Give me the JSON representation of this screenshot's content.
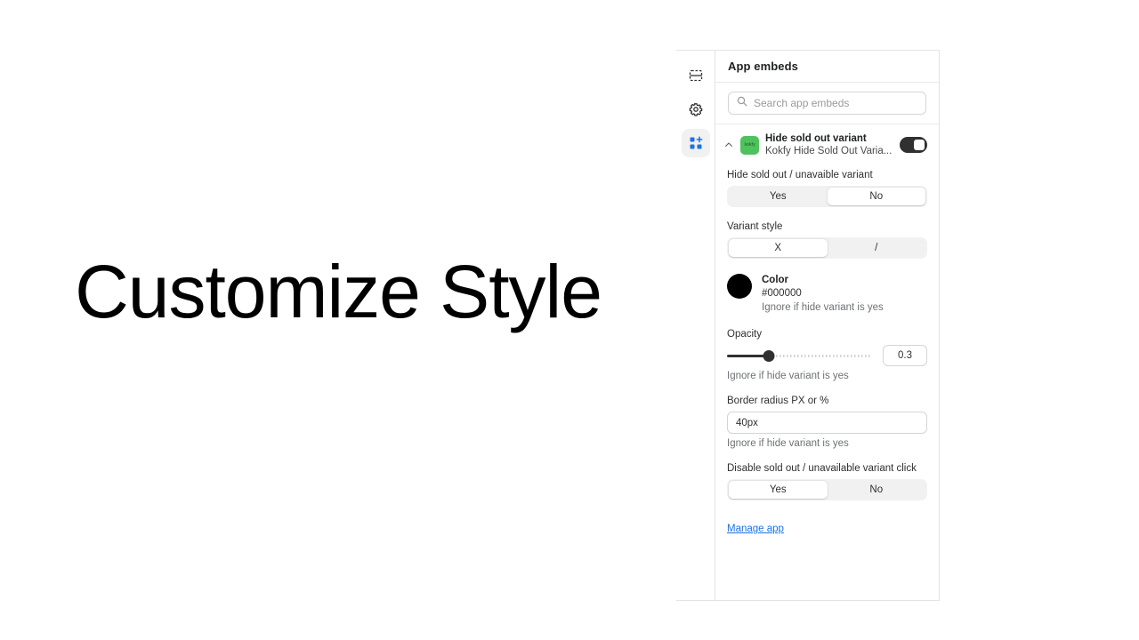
{
  "canvas": {
    "heading": "Customize Style"
  },
  "sidebar": {
    "items": [
      {
        "icon": "sections-icon",
        "name": "sections",
        "active": false
      },
      {
        "icon": "gear-icon",
        "name": "settings",
        "active": false
      },
      {
        "icon": "app-blocks-icon",
        "name": "app-embeds",
        "active": true
      }
    ]
  },
  "panel": {
    "title": "App embeds",
    "search": {
      "placeholder": "Search app embeds",
      "value": "",
      "icon": "search-icon"
    },
    "app": {
      "name": "Hide sold out variant",
      "subtitle": "Kokfy Hide Sold Out Varia...",
      "icon_label": "kokfy",
      "icon_color": "#4fc25d",
      "toggle_on": true,
      "caret": "collapse-caret-up"
    },
    "settings": {
      "hide_sold_out": {
        "label": "Hide sold out / unavaible variant",
        "options": [
          "Yes",
          "No"
        ],
        "selected": "No"
      },
      "variant_style": {
        "label": "Variant style",
        "options": [
          "X",
          "/"
        ],
        "selected": "X"
      },
      "color": {
        "label": "Color",
        "value": "#000000",
        "helper": "Ignore if hide variant is yes"
      },
      "opacity": {
        "label": "Opacity",
        "value": "0.3",
        "fill_percent": 29,
        "helper": "Ignore if hide variant is yes"
      },
      "border_radius": {
        "label": "Border radius PX or %",
        "value": "40px",
        "placeholder": "",
        "helper": "Ignore if hide variant is yes"
      },
      "disable_click": {
        "label": "Disable sold out / unavailable variant click",
        "options": [
          "Yes",
          "No"
        ],
        "selected": "Yes"
      }
    },
    "manage_app_label": "Manage app"
  },
  "colors": {
    "accent_link": "#1a73e8",
    "toggle_on": "#303030",
    "app_icon": "#4fc25d",
    "active_rail": "#1a73e8"
  }
}
